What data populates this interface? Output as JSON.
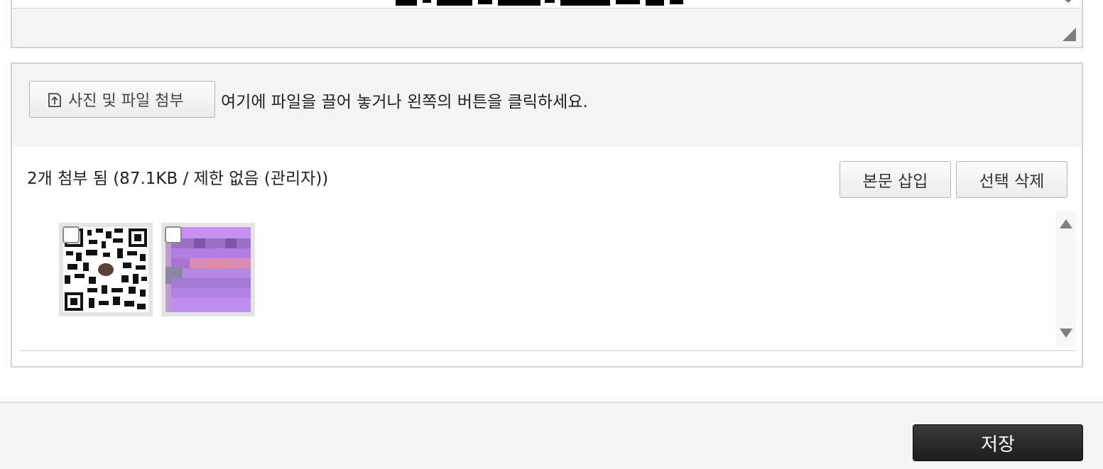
{
  "uploader": {
    "attach_button_label": "사진 및 파일 첨부",
    "attach_icon": "upload-icon",
    "drop_hint": "여기에 파일을 끌어 놓거나 왼쪽의 버튼을 클릭하세요.",
    "summary": "2개 첨부 됨 (87.1KB / 제한 없음 (관리자))",
    "insert_button_label": "본문 삽입",
    "delete_button_label": "선택 삭제",
    "files": [
      {
        "kind": "qr-code-image",
        "checked": false
      },
      {
        "kind": "pixelated-purple-image",
        "checked": false
      }
    ]
  },
  "footer": {
    "save_button_label": "저장"
  },
  "colors": {
    "panel_background": "#f3f4f3",
    "border": "#cfd3d2",
    "save_button": "#2a2a2a",
    "thumb_purple": "#c690f0"
  }
}
